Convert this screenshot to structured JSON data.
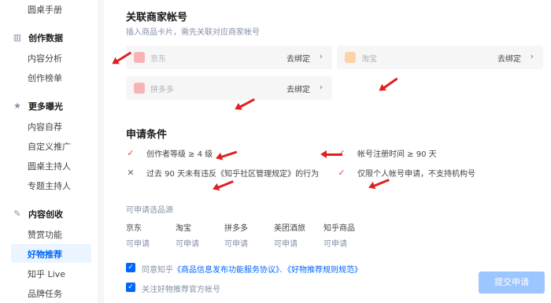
{
  "sidebar": {
    "top_item": "圆桌手册",
    "sections": [
      {
        "title": "创作数据",
        "icon": "bar-chart-icon",
        "items": [
          "内容分析",
          "创作榜单"
        ]
      },
      {
        "title": "更多曝光",
        "icon": "star-icon",
        "items": [
          "内容自荐",
          "自定义推广",
          "圆桌主持人",
          "专题主持人"
        ]
      },
      {
        "title": "内容创收",
        "icon": "pen-icon",
        "items": [
          "赞赏功能",
          "好物推荐",
          "知乎 Live",
          "品牌任务"
        ]
      }
    ],
    "active_item": "好物推荐"
  },
  "bind_section": {
    "title": "关联商家帐号",
    "subtitle": "插入商品卡片，需先关联对应商家帐号",
    "cards": [
      {
        "name": "京东",
        "action": "去绑定",
        "color": "#f8b4b4"
      },
      {
        "name": "淘宝",
        "action": "去绑定",
        "color": "#fcd3a8"
      },
      {
        "name": "拼多多",
        "action": "去绑定",
        "color": "#f8b4b4"
      }
    ]
  },
  "conditions": {
    "title": "申请条件",
    "items": [
      {
        "text": "创作者等级 ≥ 4 级",
        "met": true
      },
      {
        "text": "帐号注册时间 ≥ 90 天",
        "met": true
      },
      {
        "text": "过去 90 天未有违反《知乎社区管理规定》的行为",
        "met": false
      },
      {
        "text": "仅限个人帐号申请，不支持机构号",
        "met": true
      }
    ]
  },
  "sources": {
    "title": "可申请选品源",
    "items": [
      {
        "name": "京东",
        "status": "可申请"
      },
      {
        "name": "淘宝",
        "status": "可申请"
      },
      {
        "name": "拼多多",
        "status": "可申请"
      },
      {
        "name": "美团酒旅",
        "status": "可申请"
      },
      {
        "name": "知乎商品",
        "status": "可申请"
      }
    ]
  },
  "agreements": {
    "line1_prefix": "同意知乎",
    "link1": "《商品信息发布功能服务协议》",
    "sep": "、",
    "link2": "《好物推荐规则规范》",
    "line2": "关注好物推荐官方帐号"
  },
  "submit_label": "提交申请",
  "annotation_color": "#e02020"
}
